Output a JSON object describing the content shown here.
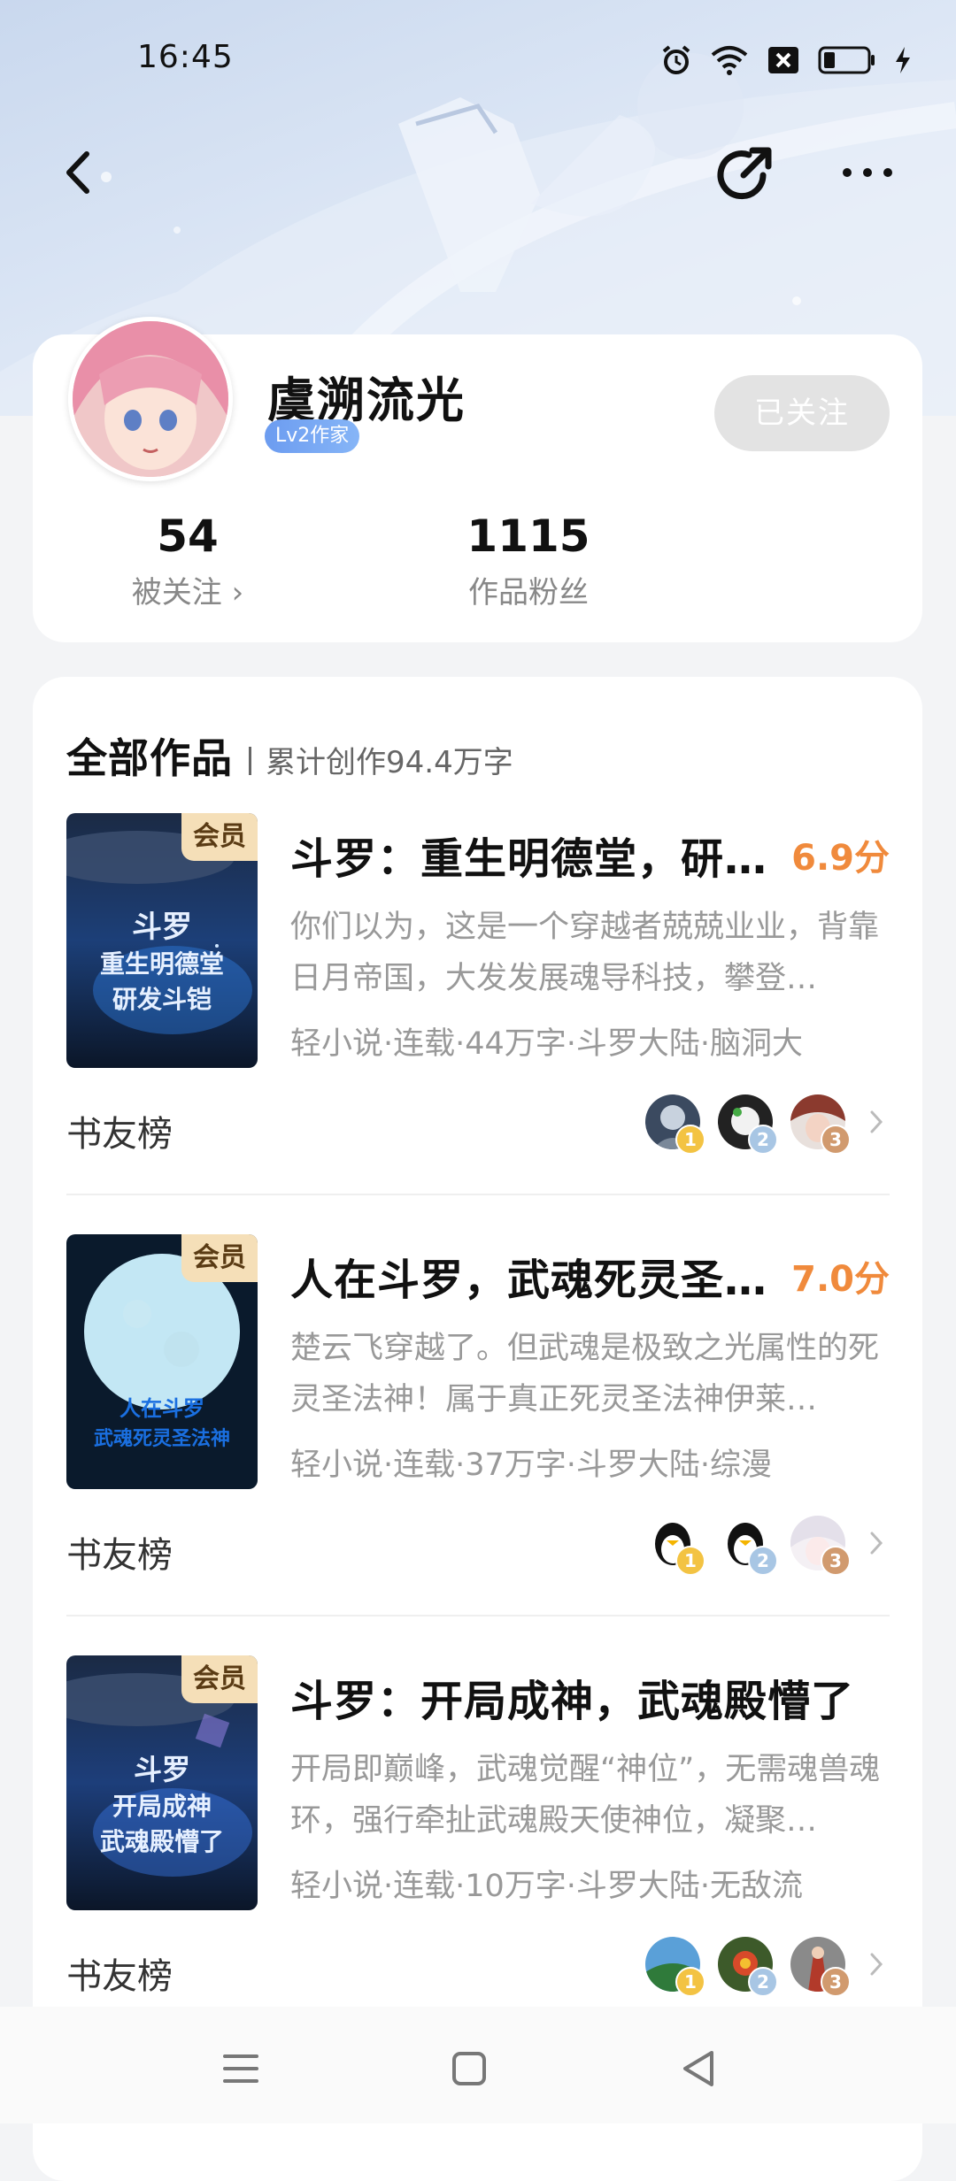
{
  "status_bar": {
    "time": "16:45",
    "icons": [
      "alarm-icon",
      "wifi-icon",
      "sim-off-icon",
      "battery-icon",
      "charging-icon"
    ]
  },
  "nav": {
    "back_icon": "chevron-left-icon",
    "share_icon": "share-icon",
    "more_icon": "more-icon"
  },
  "profile": {
    "name": "虞溯流光",
    "level": "Lv2作家",
    "follow_button": "已关注",
    "stats": [
      {
        "value": "54",
        "label": "被关注 ›"
      },
      {
        "value": "1115",
        "label": "作品粉丝"
      }
    ]
  },
  "works": {
    "title": "全部作品",
    "summary": "累计创作94.4万字",
    "vip_label": "会员",
    "fans_label": "书友榜",
    "books": [
      {
        "title": "斗罗：重生明德堂，研…",
        "score": "6.9分",
        "desc": "你们以为，这是一个穿越者兢兢业业，背靠日月帝国，大发发展魂导科技，攀登…",
        "meta": "轻小说·连载·44万字·斗罗大陆·脑洞大",
        "cover_text": [
          "斗罗",
          "重生明德堂",
          "研发斗铠"
        ],
        "ranks": [
          "1",
          "2",
          "3"
        ]
      },
      {
        "title": "人在斗罗，武魂死灵圣…",
        "score": "7.0分",
        "desc": "楚云飞穿越了。但武魂是极致之光属性的死灵圣法神！属于真正死灵圣法神伊莱…",
        "meta": "轻小说·连载·37万字·斗罗大陆·综漫",
        "cover_text": [
          "人在斗罗",
          "武魂死灵圣法神"
        ],
        "ranks": [
          "1",
          "2",
          "3"
        ]
      },
      {
        "title": "斗罗：开局成神，武魂殿懵了",
        "score": "",
        "desc": "开局即巅峰，武魂觉醒“神位”，无需魂兽魂环，强行牵扯武魂殿天使神位，凝聚…",
        "meta": "轻小说·连载·10万字·斗罗大陆·无敌流",
        "cover_text": [
          "斗罗",
          "开局成神",
          "武魂殿懵了"
        ],
        "ranks": [
          "1",
          "2",
          "3"
        ]
      }
    ]
  },
  "navbar": {
    "icons": [
      "menu-icon",
      "home-square-icon",
      "back-triangle-icon"
    ]
  }
}
